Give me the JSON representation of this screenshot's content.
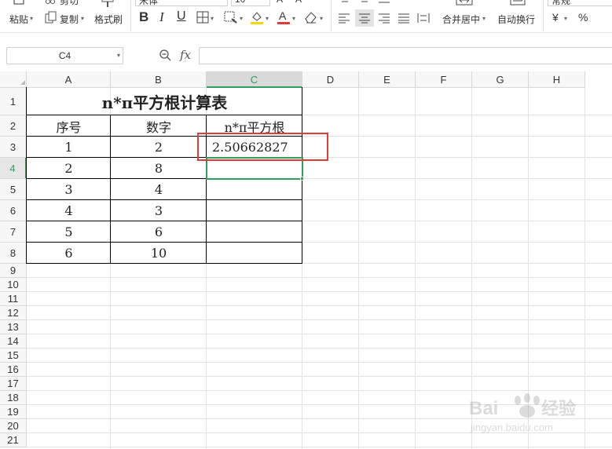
{
  "ribbon": {
    "paste_label": "粘贴",
    "copy_label": "复制",
    "cut_label": "剪切",
    "format_painter_label": "格式刷",
    "font_name": "宋体",
    "font_size": "10",
    "merge_label": "合并居中",
    "wrap_label": "自动换行",
    "number_format": "常规",
    "currency_symbol": "¥",
    "percent_symbol": "%"
  },
  "formula_bar": {
    "name_box": "C4",
    "fx_label": "fx",
    "formula": ""
  },
  "columns": [
    "A",
    "B",
    "C",
    "D",
    "E",
    "F",
    "G",
    "H"
  ],
  "rows": [
    "1",
    "2",
    "3",
    "4",
    "5",
    "6",
    "7",
    "8",
    "9",
    "10",
    "11",
    "12",
    "13",
    "14",
    "15",
    "16",
    "17",
    "18",
    "19",
    "20",
    "21"
  ],
  "selected_cell": "C4",
  "table": {
    "title": "n*π平方根计算表",
    "headers": [
      "序号",
      "数字",
      "n*π平方根"
    ],
    "data": [
      [
        "1",
        "2",
        "2.50662827"
      ],
      [
        "2",
        "8",
        ""
      ],
      [
        "3",
        "4",
        ""
      ],
      [
        "4",
        "3",
        ""
      ],
      [
        "5",
        "6",
        ""
      ],
      [
        "6",
        "10",
        ""
      ]
    ]
  },
  "colors": {
    "selection": "#2e9e5f",
    "annotation": "#e53935"
  },
  "watermark": "Baidu经验 jingyan.baidu.com"
}
